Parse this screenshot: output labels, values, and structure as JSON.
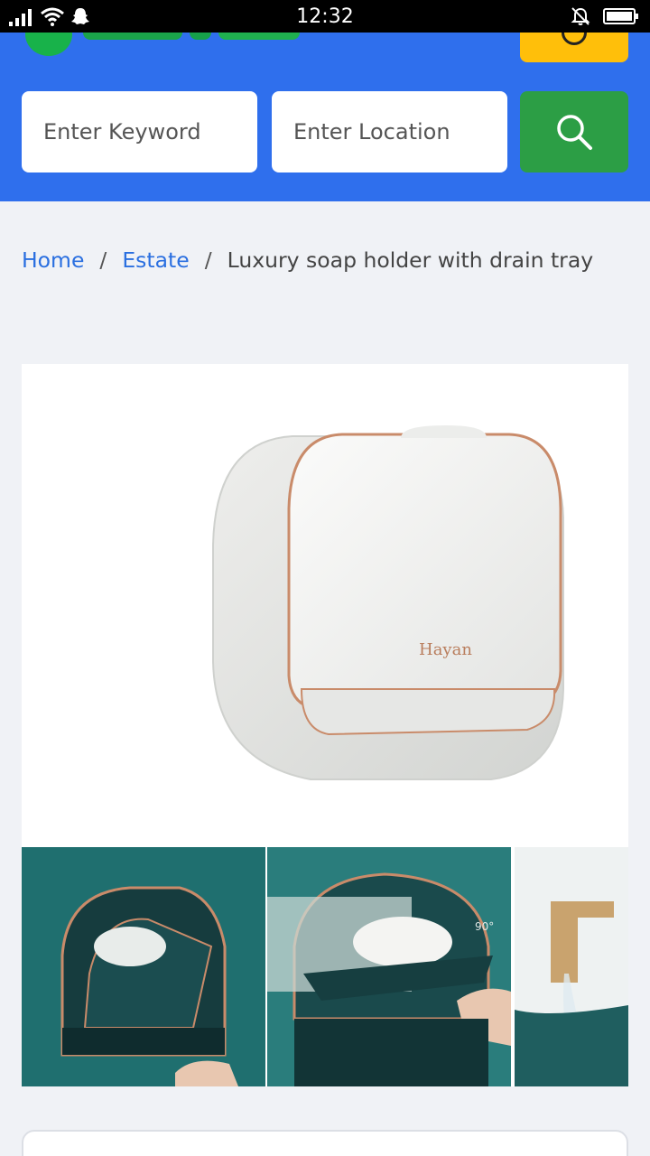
{
  "status_bar": {
    "time": "12:32",
    "icons": [
      "signal-icon",
      "wifi-icon",
      "snapchat-icon",
      "bell-muted-icon",
      "battery-icon"
    ]
  },
  "header": {
    "logo_icon": "logo-icon",
    "menu_icon": "menu-icon",
    "keyword_placeholder": "Enter Keyword",
    "location_placeholder": "Enter Location",
    "search_icon": "search-icon",
    "colors": {
      "header_bg": "#2f6fed",
      "search_button": "#2c9e45",
      "menu_button": "#ffbf0a"
    }
  },
  "breadcrumb": {
    "items": [
      {
        "label": "Home"
      },
      {
        "label": "Estate"
      }
    ],
    "separator": "/",
    "current": "Luxury soap holder with drain tray"
  },
  "product": {
    "brand_mark": "Hayan",
    "angle_label": "90°"
  }
}
